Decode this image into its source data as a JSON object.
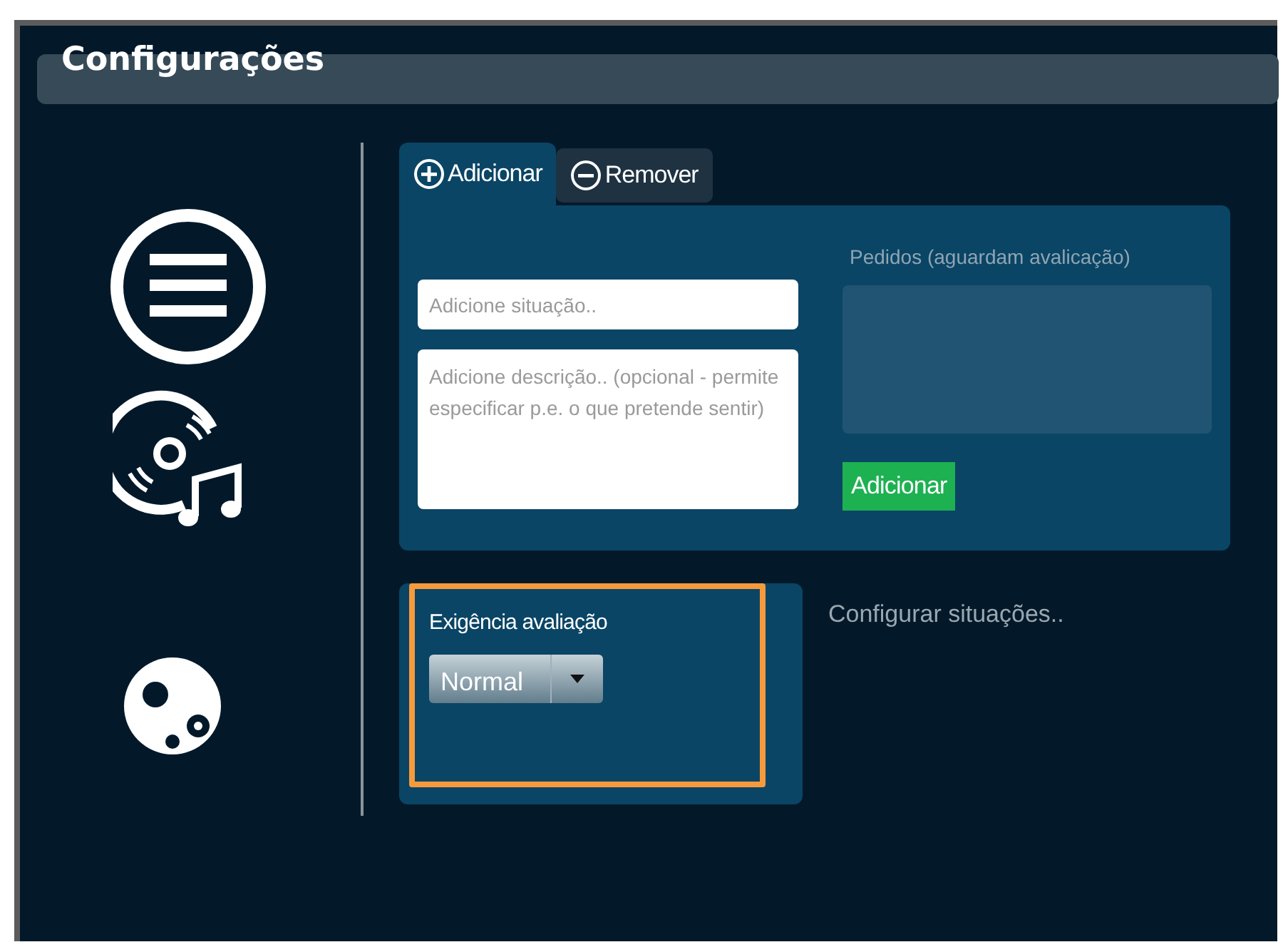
{
  "header": {
    "title": "Configurações"
  },
  "tabs": [
    {
      "label": "Adicionar",
      "kind": "add",
      "selected": true
    },
    {
      "label": "Remover",
      "kind": "remove",
      "selected": false
    }
  ],
  "form": {
    "situation_placeholder": "Adicione situação..",
    "description_placeholder": "Adicione descrição.. (opcional - permite especificar p.e. o que pretende sentir)"
  },
  "requests": {
    "label": "Pedidos (aguardam avalicação)",
    "button": "Adicionar"
  },
  "evaluation": {
    "label": "Exigência avaliação",
    "value": "Normal",
    "highlighted": true
  },
  "configure_link": "Configurar situações.."
}
